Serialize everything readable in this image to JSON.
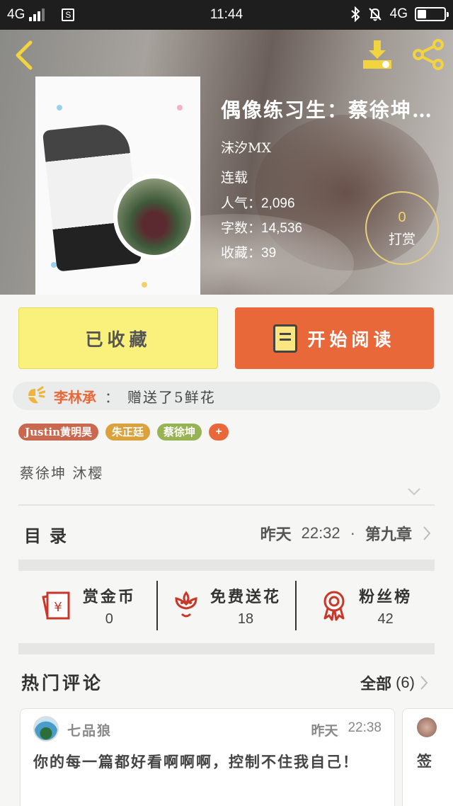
{
  "status_bar": {
    "network_left": "4G",
    "time": "11:44",
    "network_right": "4G"
  },
  "colors": {
    "accent_orange": "#e9683a",
    "collected_yellow": "#faf17c",
    "icon_red": "#c8372a",
    "icon_yellow": "#f0c232"
  },
  "book": {
    "title": "偶像练习生：蔡徐坤…",
    "author": "沫汐MX",
    "status": "连载",
    "popularity_label": "人气：",
    "popularity": "2,096",
    "words_label": "字数：",
    "words": "14,536",
    "favorites_label": "收藏：",
    "favorites": "39",
    "tip_count": "0",
    "tip_label": "打赏"
  },
  "actions": {
    "collected_label": "已收藏",
    "read_label": "开始阅读"
  },
  "gift_banner": {
    "user": "李林承",
    "colon": "：",
    "message": "赠送了5鲜花"
  },
  "tags": [
    {
      "label": "Justin黄明昊",
      "color": "#c9684f"
    },
    {
      "label": "朱正廷",
      "color": "#d9a23c"
    },
    {
      "label": "蔡徐坤",
      "color": "#98b353"
    },
    {
      "label": "+",
      "color": "#e9683a"
    }
  ],
  "characters": "蔡徐坤 沐樱",
  "toc": {
    "label": "目录",
    "date": "昨天",
    "time": "22:32",
    "separator": "·",
    "chapter": "第九章"
  },
  "stats": [
    {
      "label": "赏金币",
      "value": "0",
      "icon": "red-envelope-icon"
    },
    {
      "label": "免费送花",
      "value": "18",
      "icon": "flower-icon"
    },
    {
      "label": "粉丝榜",
      "value": "42",
      "icon": "medal-icon"
    }
  ],
  "comments": {
    "title": "热门评论",
    "all_label": "全部",
    "count": "(6)",
    "items": [
      {
        "user": "七品狼",
        "date": "昨天",
        "time": "22:38",
        "text": "你的每一篇都好看啊啊啊，控制不住我自己！"
      },
      {
        "text": "签"
      }
    ]
  }
}
